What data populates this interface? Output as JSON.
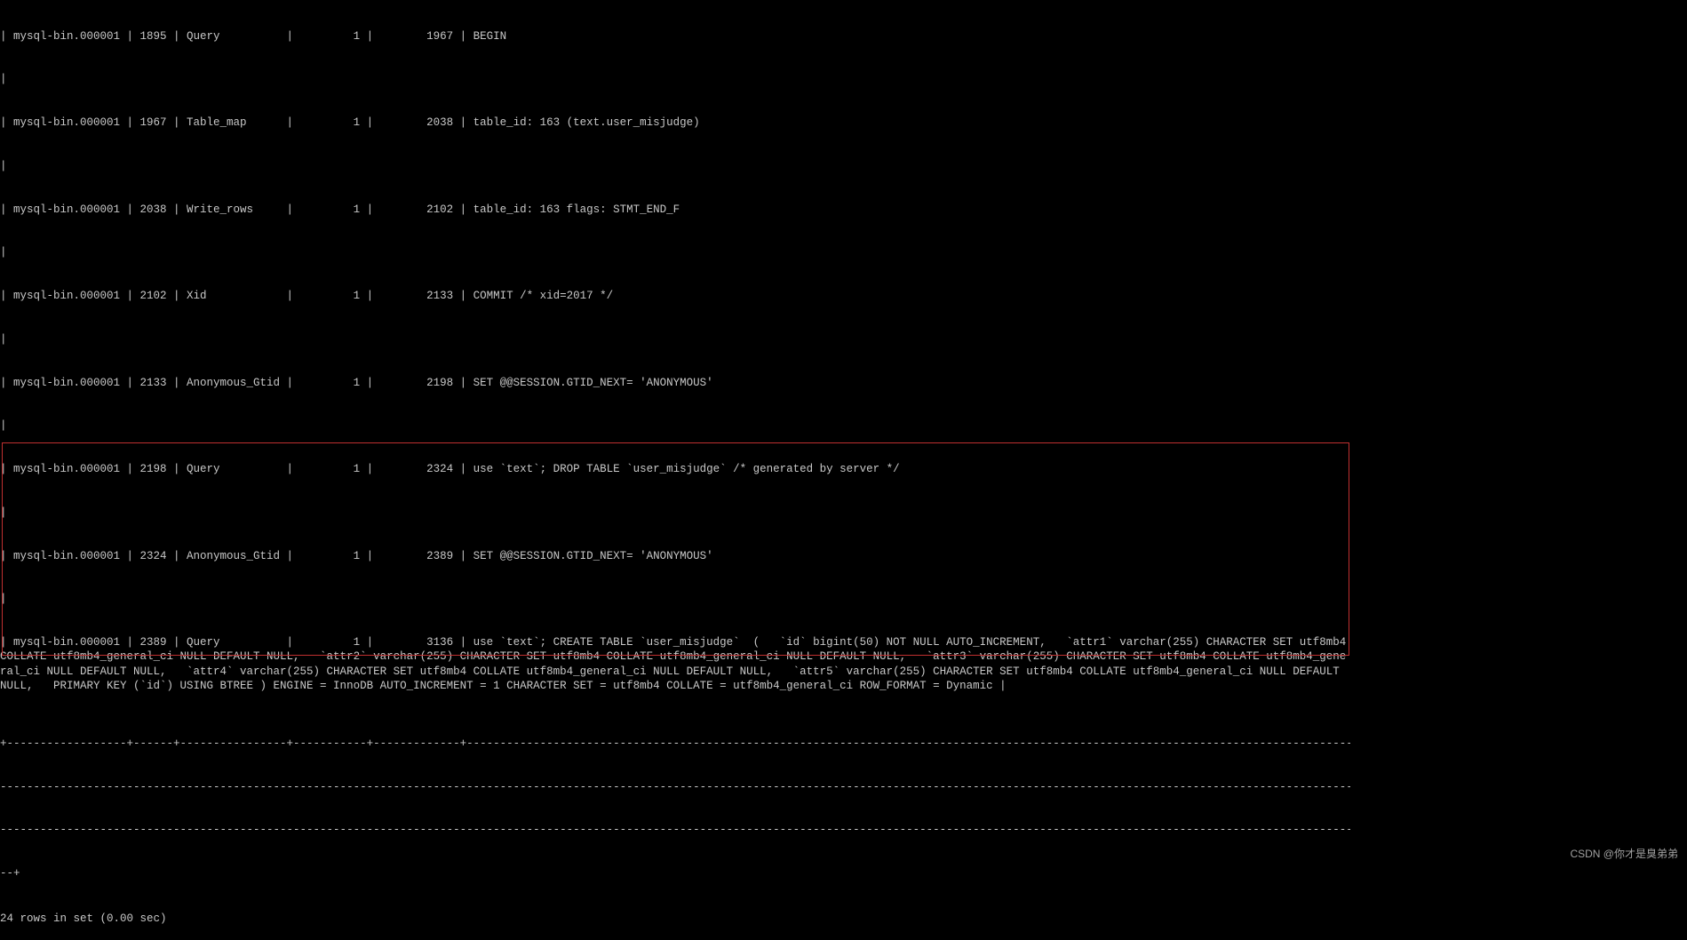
{
  "binlog_rows": [
    {
      "log": "mysql-bin.000001",
      "pos": "1895",
      "type": "Query",
      "server": "1",
      "end": "1967",
      "info": "BEGIN"
    },
    {
      "log": "mysql-bin.000001",
      "pos": "1967",
      "type": "Table_map",
      "server": "1",
      "end": "2038",
      "info": "table_id: 163 (text.user_misjudge)"
    },
    {
      "log": "mysql-bin.000001",
      "pos": "2038",
      "type": "Write_rows",
      "server": "1",
      "end": "2102",
      "info": "table_id: 163 flags: STMT_END_F"
    },
    {
      "log": "mysql-bin.000001",
      "pos": "2102",
      "type": "Xid",
      "server": "1",
      "end": "2133",
      "info": "COMMIT /* xid=2017 */"
    },
    {
      "log": "mysql-bin.000001",
      "pos": "2133",
      "type": "Anonymous_Gtid",
      "server": "1",
      "end": "2198",
      "info": "SET @@SESSION.GTID_NEXT= 'ANONYMOUS'"
    },
    {
      "log": "mysql-bin.000001",
      "pos": "2198",
      "type": "Query",
      "server": "1",
      "end": "2324",
      "info": "use `text`; DROP TABLE `user_misjudge` /* generated by server */"
    },
    {
      "log": "mysql-bin.000001",
      "pos": "2324",
      "type": "Anonymous_Gtid",
      "server": "1",
      "end": "2389",
      "info": "SET @@SESSION.GTID_NEXT= 'ANONYMOUS'"
    }
  ],
  "last_row": {
    "log": "mysql-bin.000001",
    "pos": "2389",
    "type": "Query",
    "server": "1",
    "end": "3136",
    "info": "use `text`; CREATE TABLE `user_misjudge`  (   `id` bigint(50) NOT NULL AUTO_INCREMENT,   `attr1` varchar(255) CHARACTER SET utf8mb4 COLLATE utf8mb4_general_ci NULL DEFAULT NULL,   `attr2` varchar(255) CHARACTER SET utf8mb4 COLLATE utf8mb4_general_ci NULL DEFAULT NULL,   `attr3` varchar(255) CHARACTER SET utf8mb4 COLLATE utf8mb4_general_ci NULL DEFAULT NULL,   `attr4` varchar(255) CHARACTER SET utf8mb4 COLLATE utf8mb4_general_ci NULL DEFAULT NULL,   `attr5` varchar(255) CHARACTER SET utf8mb4 COLLATE utf8mb4_general_ci NULL DEFAULT NULL,   PRIMARY KEY (`id`) USING BTREE ) ENGINE = InnoDB AUTO_INCREMENT = 1 CHARACTER SET = utf8mb4 COLLATE = utf8mb4_general_ci ROW_FORMAT = Dynamic |"
  },
  "sep1": "+------------------+------+----------------+-----------+-------------+---------------------------------------------------------------------------------------------------------------------------------------------------------------------------",
  "sep2": "---------------------------------------------------------------------------------------------------------------------------------------------------------------------------------------------------------------------------",
  "sep3": "---------------------------------------------------------------------------------------------------------------------------------------------------------------------------------------------------------------------------",
  "sep4": "--+",
  "result": "24 rows in set (0.00 sec)",
  "watermark": "CSDN @你才是臭弟弟"
}
